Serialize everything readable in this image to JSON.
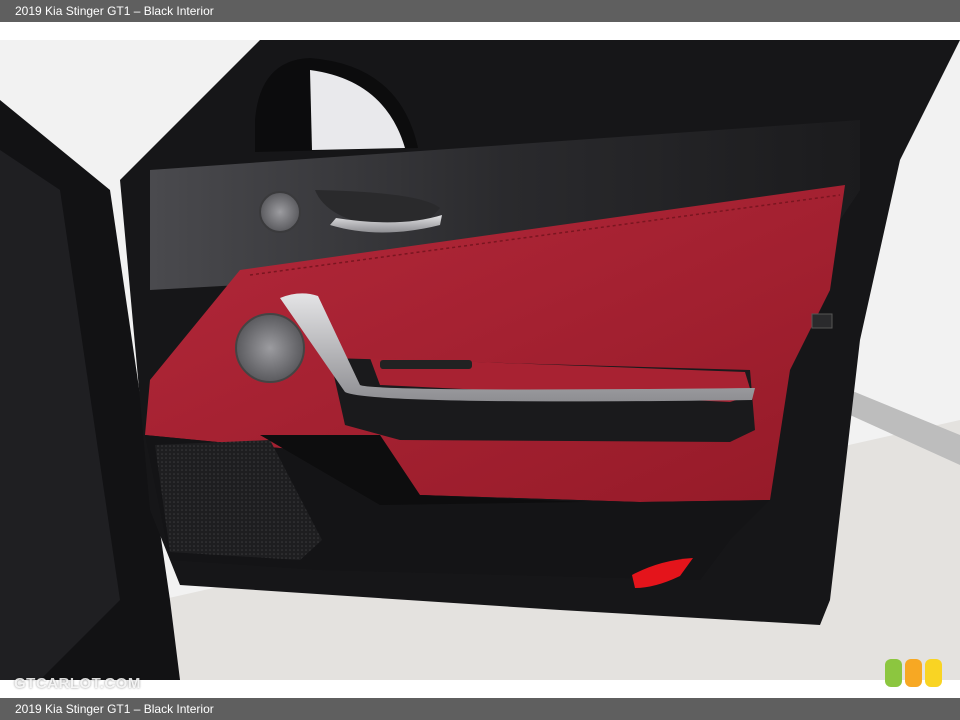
{
  "caption": {
    "top": "2019 Kia Stinger GT1 – Black Interior",
    "bottom": "2019 Kia Stinger GT1 – Black Interior"
  },
  "watermark": "GTCARLOT.COM",
  "logo": {
    "colors": [
      "#8cc63f",
      "#f7a823",
      "#f9d423"
    ]
  },
  "photo": {
    "subject": "door-interior-panel",
    "colors": {
      "leather": "#a81e2e",
      "trim": "#1c1c1e",
      "metal": "#b8b8bc",
      "background": "#f1f1f1"
    }
  }
}
